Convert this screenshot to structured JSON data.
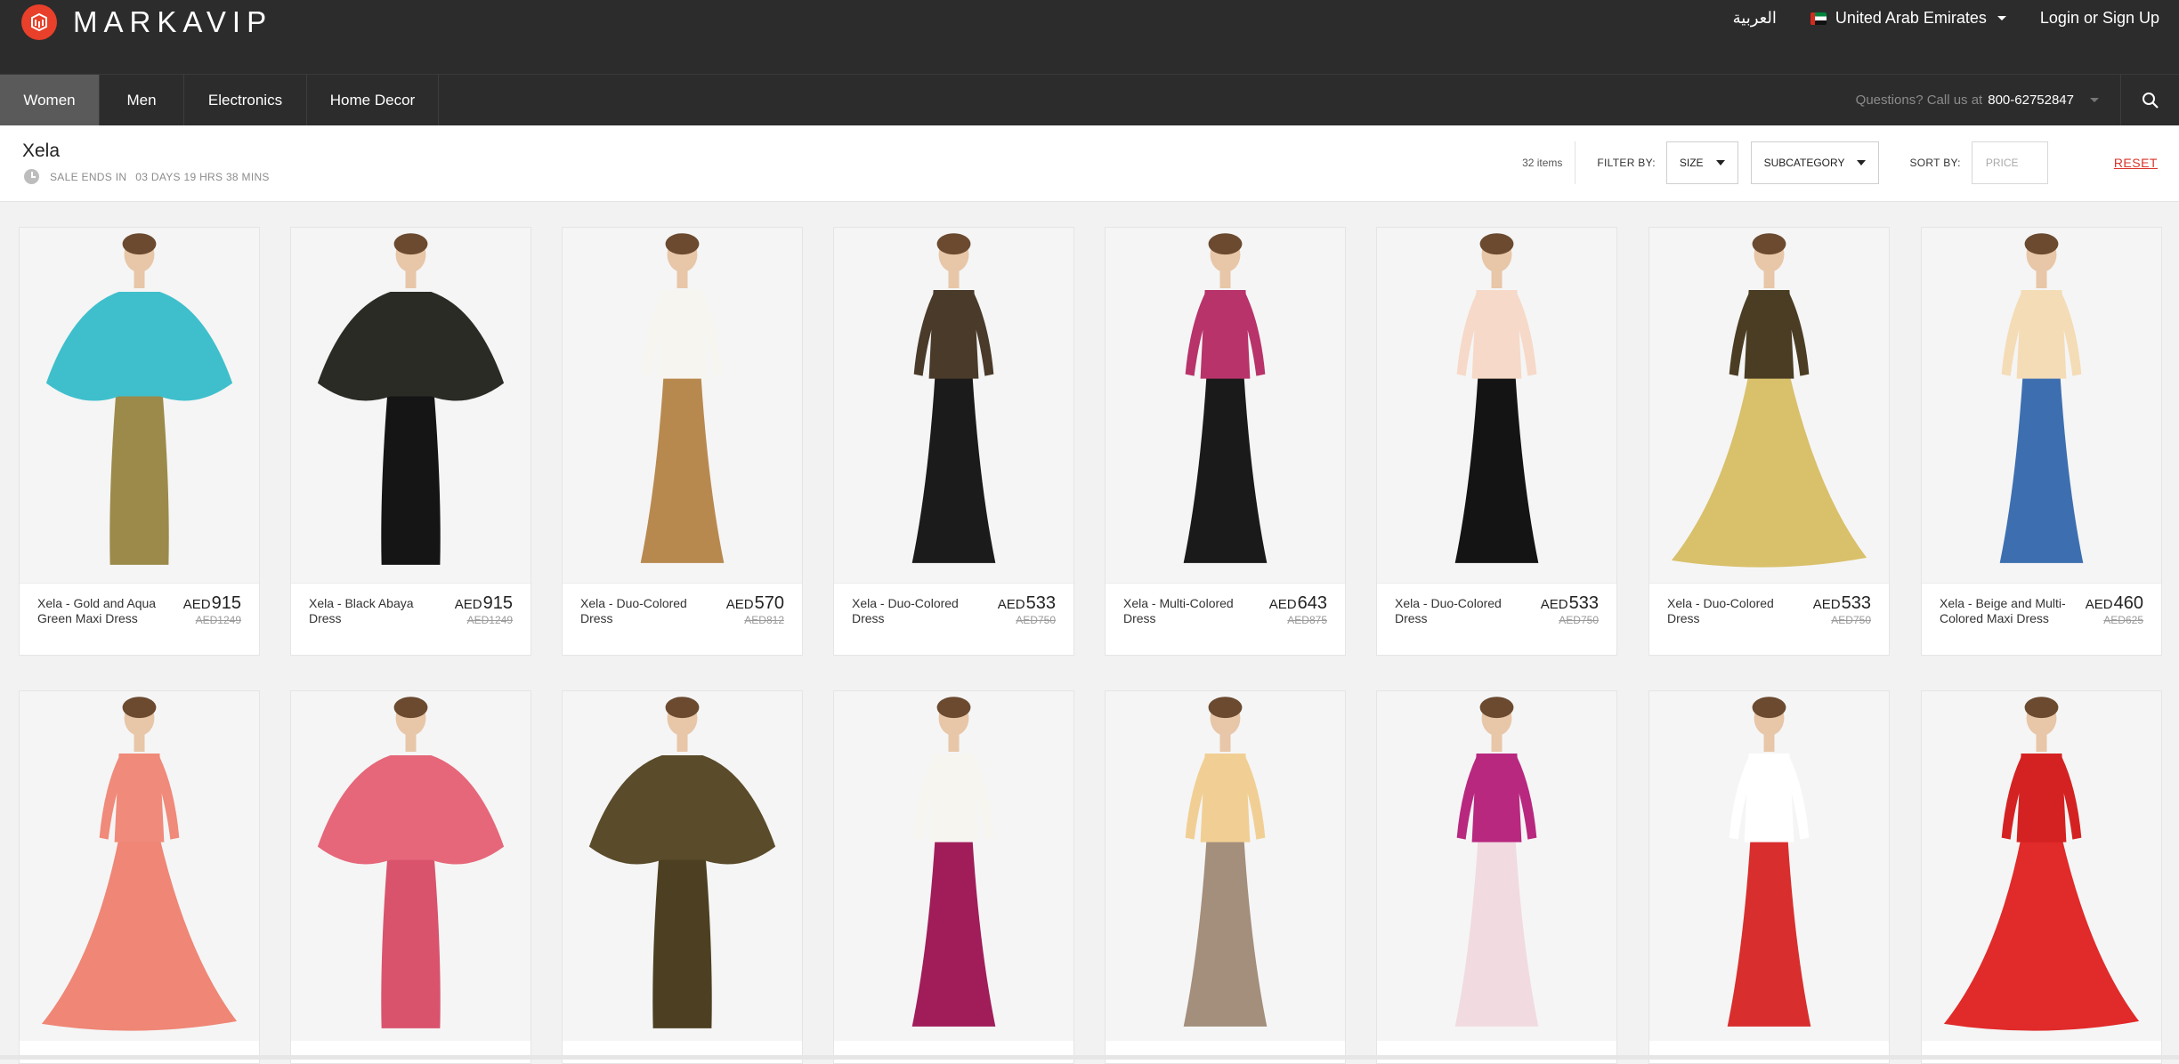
{
  "header": {
    "logo_text": "MARKAVIP",
    "language": "العربية",
    "country": "United Arab Emirates",
    "login": "Login or Sign Up"
  },
  "nav": {
    "items": [
      {
        "label": "Women",
        "active": true
      },
      {
        "label": "Men",
        "active": false
      },
      {
        "label": "Electronics",
        "active": false
      },
      {
        "label": "Home Decor",
        "active": false
      }
    ],
    "questions_label": "Questions? Call us at",
    "phone": "800-62752847"
  },
  "sale": {
    "title": "Xela",
    "ends_label": "SALE ENDS IN",
    "ends_time": "03 DAYS 19 HRS 38 MINS"
  },
  "filters": {
    "items_count": "32 items",
    "filter_by_label": "FILTER BY:",
    "size_label": "SIZE",
    "subcategory_label": "SUBCATEGORY",
    "sort_by_label": "SORT BY:",
    "price_placeholder": "PRICE",
    "reset_label": "RESET"
  },
  "products_row1": [
    {
      "name": "Xela - Gold and Aqua Green Maxi Dress",
      "currency": "AED",
      "price": "915",
      "was": "AED1249",
      "top": "#3fbfcc",
      "bottom": "#9b8a4a",
      "style": "kaftan"
    },
    {
      "name": "Xela - Black Abaya Dress",
      "currency": "AED",
      "price": "915",
      "was": "AED1249",
      "top": "#2b2b26",
      "bottom": "#151515",
      "style": "kaftan"
    },
    {
      "name": "Xela - Duo-Colored Dress",
      "currency": "AED",
      "price": "570",
      "was": "AED812",
      "top": "#f7f5f0",
      "bottom": "#b8894f",
      "style": "maxi"
    },
    {
      "name": "Xela - Duo-Colored Dress",
      "currency": "AED",
      "price": "533",
      "was": "AED750",
      "top": "#4a3a2a",
      "bottom": "#1b1b1b",
      "style": "maxi"
    },
    {
      "name": "Xela - Multi-Colored Dress",
      "currency": "AED",
      "price": "643",
      "was": "AED875",
      "top": "#b8336a",
      "bottom": "#1a1a1a",
      "style": "maxi"
    },
    {
      "name": "Xela - Duo-Colored Dress",
      "currency": "AED",
      "price": "533",
      "was": "AED750",
      "top": "#f6d9c8",
      "bottom": "#141414",
      "style": "maxi"
    },
    {
      "name": "Xela - Duo-Colored Dress",
      "currency": "AED",
      "price": "533",
      "was": "AED750",
      "top": "#4a3d24",
      "bottom": "#d9c06a",
      "style": "ball"
    },
    {
      "name": "Xela - Beige and Multi-Colored Maxi Dress",
      "currency": "AED",
      "price": "460",
      "was": "AED625",
      "top": "#f4dcb6",
      "bottom": "#3d6fb0",
      "style": "maxi"
    }
  ],
  "products_row2": [
    {
      "top": "#f08a7a",
      "bottom": "#ef8676",
      "style": "ball"
    },
    {
      "top": "#e6677a",
      "bottom": "#d9536c",
      "style": "kaftan"
    },
    {
      "top": "#5a4b2a",
      "bottom": "#4d4022",
      "style": "kaftan"
    },
    {
      "top": "#f7f5f0",
      "bottom": "#a01d5a",
      "style": "maxi"
    },
    {
      "top": "#f1cf94",
      "bottom": "#a48e7c",
      "style": "maxi"
    },
    {
      "top": "#b8287f",
      "bottom": "#f1dbe0",
      "style": "maxi"
    },
    {
      "top": "#ffffff",
      "bottom": "#d92e2e",
      "style": "maxi"
    },
    {
      "top": "#d42222",
      "bottom": "#e12a2a",
      "style": "ball"
    }
  ]
}
